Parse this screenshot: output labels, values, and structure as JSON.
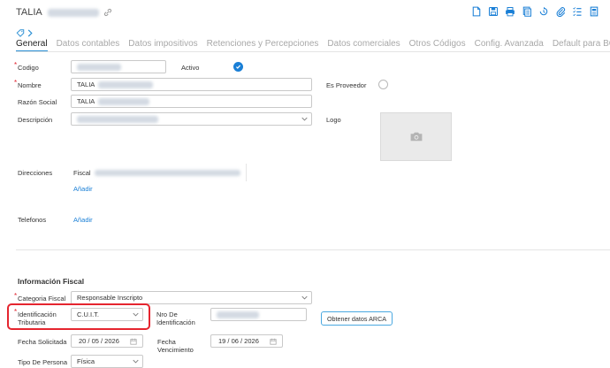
{
  "header": {
    "title": "TALIA",
    "toolbar_icons": [
      "new-document-icon",
      "save-icon",
      "print-icon",
      "copy-icon",
      "history-icon",
      "attachment-icon",
      "list-icon",
      "bookmark-icon"
    ]
  },
  "tabs": [
    {
      "label": "General",
      "active": true
    },
    {
      "label": "Datos contables"
    },
    {
      "label": "Datos impositivos"
    },
    {
      "label": "Retenciones y Percepciones"
    },
    {
      "label": "Datos comerciales"
    },
    {
      "label": "Otros Códigos"
    },
    {
      "label": "Config. Avanzada"
    },
    {
      "label": "Default para BOT"
    }
  ],
  "general": {
    "codigo_label": "Codigo",
    "activo_label": "Activo",
    "nombre_label": "Nombre",
    "nombre_value": "TALIA",
    "proveedor_label": "Es Proveedor",
    "razon_label": "Razón Social",
    "razon_value": "TALIA",
    "descripcion_label": "Descripción",
    "logo_label": "Logo",
    "direcciones_label": "Direcciones",
    "direccion_prefix": "Fiscal",
    "add_label": "Añadir",
    "telefonos_label": "Telefonos"
  },
  "fiscal": {
    "section_title": "Información Fiscal",
    "categoria_label": "Categoria Fiscal",
    "categoria_value": "Responsable Inscripto",
    "ident_label_1": "Identificación",
    "ident_label_2": "Tributaria",
    "ident_value": "C.U.I.T.",
    "nro_label_1": "Nro De",
    "nro_label_2": "Identificación",
    "arca_button": "Obtener datos ARCA",
    "fecha_sol_label": "Fecha Solicitada",
    "fecha_sol_value": "20 / 05 / 2026",
    "fecha_venc_label_1": "Fecha",
    "fecha_venc_label_2": "Vencimiento",
    "fecha_venc_value": "19 / 06 / 2026",
    "tipo_persona_label": "Tipo De Persona",
    "tipo_persona_value": "Física"
  },
  "colors": {
    "accent": "#1a7fd6",
    "highlight": "#e5252f",
    "required": "#e0202c"
  }
}
